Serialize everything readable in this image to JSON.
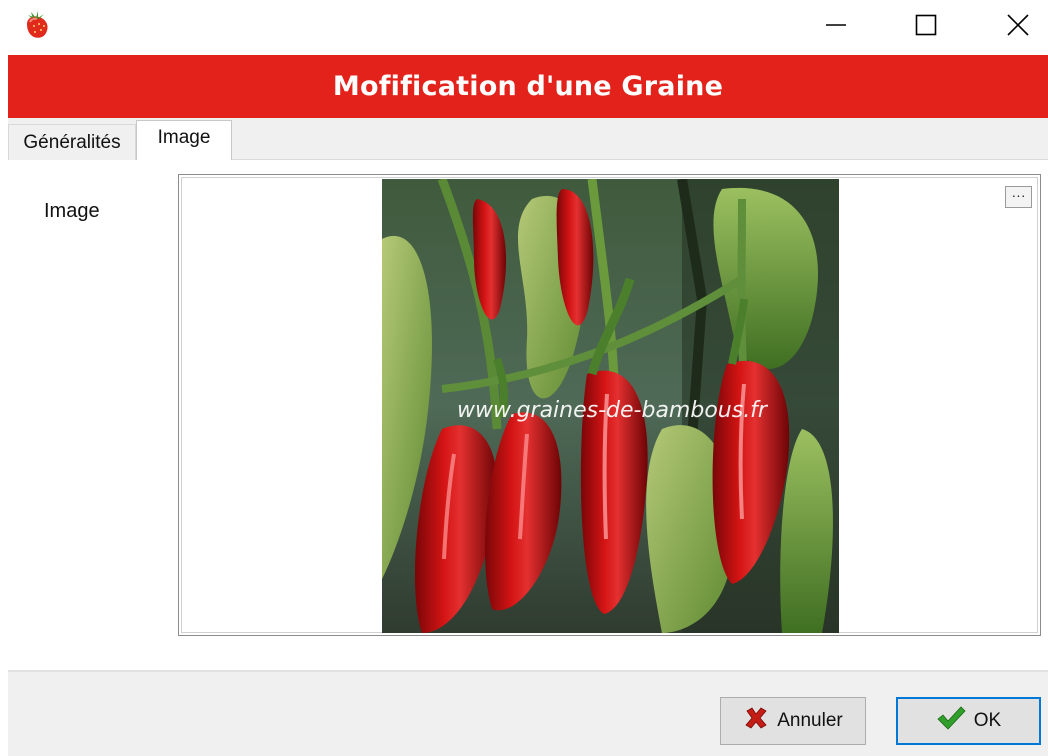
{
  "window": {
    "app_icon": "strawberry-icon",
    "controls": {
      "minimize": "minimize-icon",
      "maximize": "maximize-icon",
      "close": "close-icon"
    }
  },
  "header": {
    "title": "Mofification d'une Graine",
    "color": "#e3231b"
  },
  "tabs": [
    {
      "label": "Généralités",
      "selected": false
    },
    {
      "label": "Image",
      "selected": true
    }
  ],
  "image_field": {
    "label": "Image",
    "browse_label": "···",
    "photo_watermark": "www.graines-de-bambous.fr"
  },
  "footer": {
    "cancel_label": "Annuler",
    "cancel_icon": "x-icon",
    "ok_label": "OK",
    "ok_icon": "checkmark-icon",
    "focus_color": "#0078d7"
  }
}
